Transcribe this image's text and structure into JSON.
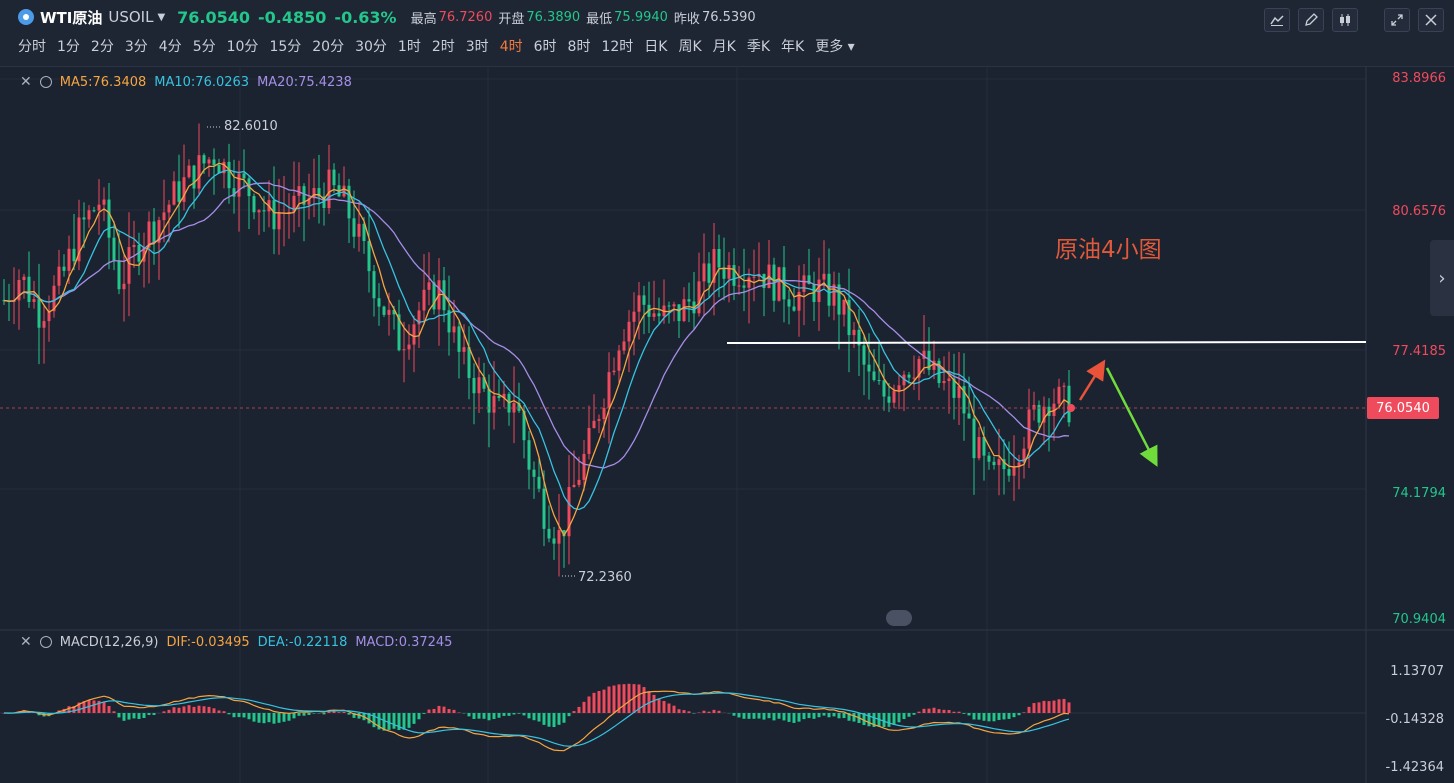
{
  "header": {
    "symbol_name": "WTI原油",
    "symbol_code": "USOIL",
    "price": "76.0540",
    "change": "-0.4850",
    "change_pct": "-0.63%",
    "stats": [
      {
        "label": "最高",
        "value": "76.7260",
        "color": "red"
      },
      {
        "label": "开盘",
        "value": "76.3890",
        "color": "green"
      },
      {
        "label": "最低",
        "value": "75.9940",
        "color": "green"
      },
      {
        "label": "昨收",
        "value": "76.5390",
        "color": "plain"
      }
    ],
    "timeframes": [
      "分时",
      "1分",
      "2分",
      "3分",
      "4分",
      "5分",
      "10分",
      "15分",
      "20分",
      "30分",
      "1时",
      "2时",
      "3时",
      "4时",
      "6时",
      "8时",
      "12时",
      "日K",
      "周K",
      "月K",
      "季K",
      "年K",
      "更多"
    ],
    "active_timeframe": "4时",
    "icons": [
      "draw-line-icon",
      "pencil-icon",
      "candle-icon",
      "expand-icon",
      "close-icon"
    ]
  },
  "main_legend": {
    "ma5": "MA5:76.3408",
    "ma10": "MA10:76.0263",
    "ma20": "MA20:75.4238"
  },
  "price_axis": [
    "83.8966",
    "80.6576",
    "77.4185",
    "74.1794",
    "70.9404"
  ],
  "current_price_tag": "76.0540",
  "high_label": "82.6010",
  "low_label": "72.2360",
  "annotation": "原油4小图",
  "macd_legend": {
    "name": "MACD(12,26,9)",
    "dif": "DIF:-0.03495",
    "dea": "DEA:-0.22118",
    "macd": "MACD:0.37245"
  },
  "macd_axis": [
    "1.13707",
    "-0.14328",
    "-1.42364"
  ],
  "colors": {
    "up": "#ef4b5d",
    "down": "#23c68b",
    "ma5": "#f5a542",
    "ma10": "#37c3e0",
    "ma20": "#a58ee6",
    "active": "#f07b3f",
    "annotation": "#e05a3a"
  }
}
